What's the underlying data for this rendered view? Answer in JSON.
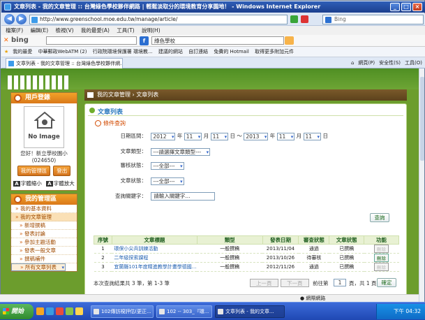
{
  "browser": {
    "title": "文章列表 - 我的文章管理 :: 台灣綠色學校夥伴網路 | 輕鬆淡取分的環境教育分享園地！ - Windows Internet Explorer",
    "address": "http://www.greenschool.moe.edu.tw/manage/article/",
    "search_engine": "Bing",
    "menu": [
      "檔案(F)",
      "編輯(E)",
      "檢視(V)",
      "我的最愛(A)",
      "工具(T)",
      "說明(H)"
    ],
    "bing_logo": "bing",
    "bing_query": "綠色學校",
    "favorites_label": "我的最愛",
    "favorites": [
      "中華郵政WebATM (2)",
      "行政院環境保護署 環境教...",
      "建議的網站",
      "自訂連結",
      "免費的 Hotmail",
      "取得更多附加元件"
    ],
    "tab_label": "文章列表 - 我的文章管理 :: 台灣綠色學校夥伴網...",
    "tools": [
      "網頁(P)",
      "安全性(S)",
      "工具(O)"
    ]
  },
  "sidebar": {
    "login_title": "用戶登錄",
    "avatar_text": "No Image",
    "greeting": "您好！新立學校園小",
    "user_id": "(024650)",
    "btn_manage": "我的管理區",
    "btn_logout": "登出",
    "font_small": "字體縮小",
    "font_large": "字體放大",
    "manage_title": "我的管理區",
    "items": [
      {
        "label": "我的基本資料",
        "style": "menu"
      },
      {
        "label": "我的文章管理",
        "style": "active"
      },
      {
        "label": "新增撰稿",
        "style": "sub"
      },
      {
        "label": "發表討論",
        "style": "sub"
      },
      {
        "label": "參加主題活動",
        "style": "sub"
      },
      {
        "label": "發表一般文章",
        "style": "sub"
      },
      {
        "label": "撰稿補件",
        "style": "sub"
      },
      {
        "label": "所有文章列表",
        "style": "sel"
      }
    ]
  },
  "breadcrumb": {
    "items": [
      "我的文章管理",
      "文章列表"
    ]
  },
  "panel": {
    "title": "文章列表",
    "condition_title": "條件查詢",
    "date_label": "日期區間：",
    "date_from": {
      "year": "2012",
      "month": "11",
      "day": "11"
    },
    "date_sep": "年",
    "tilde": "～",
    "date_to": {
      "year": "2013",
      "month": "11",
      "day": "11"
    },
    "year_unit": "年",
    "month_unit": "月",
    "day_unit": "日",
    "type_label": "文章類型：",
    "type_value": "---請選擇文章類型---",
    "review_label": "審核狀態：",
    "review_value": "---全部---",
    "status_label": "文章狀態：",
    "status_value": "---全部---",
    "keyword_label": "查詢關鍵字：",
    "keyword_value": "請輸入關鍵字...",
    "query_btn": "查詢"
  },
  "table": {
    "headers": [
      "序號",
      "文章標題",
      "類型",
      "發表日期",
      "審查狀態",
      "文章狀態",
      "功能"
    ],
    "rows": [
      {
        "no": "1",
        "title": "環保小尖兵訓練活動",
        "type": "一般撰稿",
        "date": "2013/11/04",
        "review": "通過",
        "status": "已撰稿",
        "action": "刪除"
      },
      {
        "no": "2",
        "title": "二年級探索課程",
        "type": "一般撰稿",
        "date": "2013/10/26",
        "review": "待審核",
        "status": "已撰稿",
        "action": "刪除"
      },
      {
        "no": "3",
        "title": "宜蘭縣101年度精進教學計畫學德國...",
        "type": "一般撰稿",
        "date": "2012/11/26",
        "review": "通過",
        "status": "已撰稿",
        "action": "刪除"
      }
    ]
  },
  "pager": {
    "summary": "本次查詢結果共 3 筆，第 1-3 筆",
    "prev": "上一頁",
    "next": "下一頁",
    "goto_pre": "前往第",
    "page_value": "1",
    "goto_post": "頁，共 1 頁",
    "confirm": "確定"
  },
  "status_bar": {
    "zone": "網際網路"
  },
  "taskbar": {
    "start": "開始",
    "tasks": [
      "102傳訪視評估(更正...",
      "102 -- 303_『環...",
      "文章列表 - 我的文章..."
    ],
    "clock": "下午 04:32"
  }
}
